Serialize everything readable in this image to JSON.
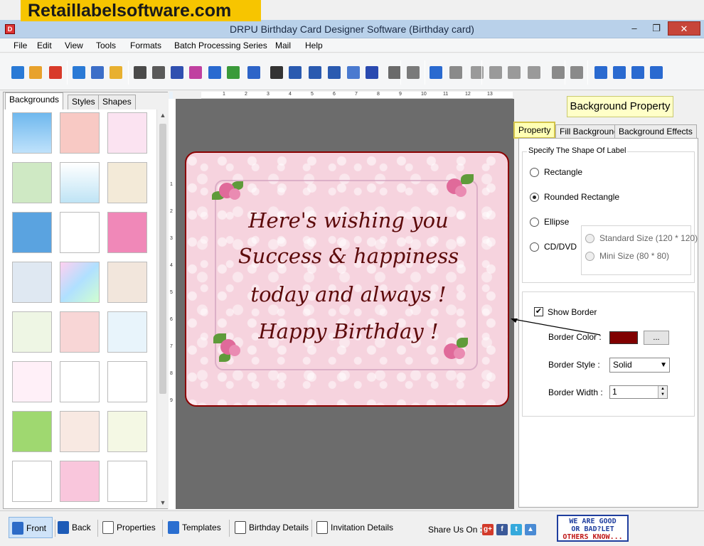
{
  "banner": "Retaillabelsoftware.com",
  "window": {
    "title": "DRPU Birthday Card Designer Software (Birthday card)"
  },
  "menu": [
    "File",
    "Edit",
    "View",
    "Tools",
    "Formats",
    "Batch Processing Series",
    "Mail",
    "Help"
  ],
  "toolbar_icons": [
    "new-icon",
    "open-icon",
    "close-doc-icon",
    "save-icon",
    "save-as-icon",
    "export-icon",
    "properties-icon",
    "print-icon",
    "print-preview-icon",
    "copy-design-icon",
    "pencil-icon",
    "image-icon",
    "barcode-icon",
    "barcode2-icon",
    "text-icon",
    "wordart-icon",
    "signature-icon",
    "email-icon",
    "line-icon",
    "database-icon",
    "database2-icon",
    "undo-icon",
    "redo-icon",
    "cut-icon",
    "copy-icon",
    "paste-icon",
    "delete-icon",
    "bring-front-icon",
    "send-back-icon",
    "grid-icon",
    "actual-size-icon",
    "fit-icon",
    "zoom-icon"
  ],
  "left_tabs": {
    "backgrounds": "Backgrounds",
    "styles": "Styles",
    "shapes": "Shapes"
  },
  "card_text": {
    "line1": "Here's wishing you",
    "line2": "Success & happiness",
    "line3": "today and always !",
    "line4": "Happy Birthday !"
  },
  "ruler_h": [
    "1",
    "2",
    "3",
    "4",
    "5",
    "6",
    "7",
    "8",
    "9",
    "10",
    "11",
    "12",
    "13"
  ],
  "ruler_v": [
    "1",
    "2",
    "3",
    "4",
    "5",
    "6",
    "7",
    "8",
    "9"
  ],
  "right": {
    "header": "Background Property",
    "tabs": {
      "property": "Property",
      "fill": "Fill Background",
      "effects": "Background Effects"
    },
    "shape_group": "Specify The Shape Of Label",
    "shapes": {
      "rectangle": "Rectangle",
      "rounded": "Rounded Rectangle",
      "ellipse": "Ellipse",
      "cd": "CD/DVD"
    },
    "sizes": {
      "standard": "Standard Size (120 * 120)",
      "mini": "Mini Size (80 * 80)"
    },
    "show_border": "Show Border",
    "border_color_label": "Border Color :",
    "border_color": "#800000",
    "more_btn": "...",
    "border_style_label": "Border Style :",
    "border_style": "Solid",
    "border_width_label": "Border Width :",
    "border_width": "1"
  },
  "bottom": {
    "front": "Front",
    "back": "Back",
    "properties": "Properties",
    "templates": "Templates",
    "birthday_details": "Birthday Details",
    "invitation_details": "Invitation Details",
    "share": "Share Us On :",
    "goodbad_l1": "WE ARE GOOD",
    "goodbad_l2": "OR BAD?LET",
    "goodbad_l3": "OTHERS KNOW..."
  }
}
